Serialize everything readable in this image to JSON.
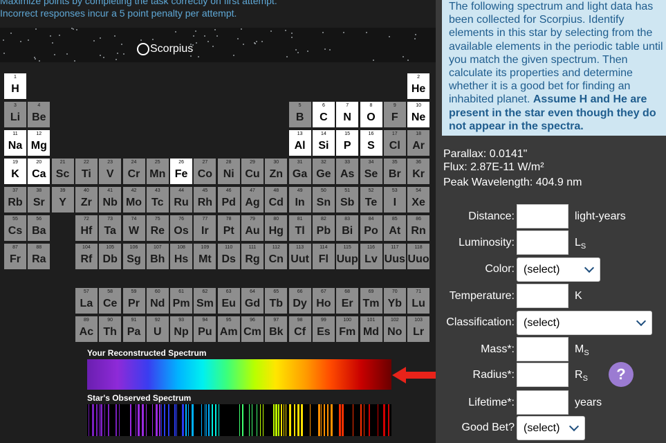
{
  "top_note": {
    "line1": "Maximize points by completing the task correctly on first attempt.",
    "line2": "Incorrect responses incur a 5 point penalty per attempt."
  },
  "star_name": "Scorpius",
  "elements": [
    {
      "n": "1",
      "s": "H",
      "r": 0,
      "c": 0,
      "on": true
    },
    {
      "n": "2",
      "s": "He",
      "r": 0,
      "c": 17,
      "on": true
    },
    {
      "n": "3",
      "s": "Li",
      "r": 1,
      "c": 0
    },
    {
      "n": "4",
      "s": "Be",
      "r": 1,
      "c": 1
    },
    {
      "n": "5",
      "s": "B",
      "r": 1,
      "c": 12
    },
    {
      "n": "6",
      "s": "C",
      "r": 1,
      "c": 13,
      "on": true
    },
    {
      "n": "7",
      "s": "N",
      "r": 1,
      "c": 14,
      "on": true
    },
    {
      "n": "8",
      "s": "O",
      "r": 1,
      "c": 15,
      "on": true
    },
    {
      "n": "9",
      "s": "F",
      "r": 1,
      "c": 16
    },
    {
      "n": "10",
      "s": "Ne",
      "r": 1,
      "c": 17,
      "on": true
    },
    {
      "n": "11",
      "s": "Na",
      "r": 2,
      "c": 0,
      "on": true
    },
    {
      "n": "12",
      "s": "Mg",
      "r": 2,
      "c": 1,
      "on": true
    },
    {
      "n": "13",
      "s": "Al",
      "r": 2,
      "c": 12,
      "on": true
    },
    {
      "n": "14",
      "s": "Si",
      "r": 2,
      "c": 13,
      "on": true
    },
    {
      "n": "15",
      "s": "P",
      "r": 2,
      "c": 14,
      "on": true
    },
    {
      "n": "16",
      "s": "S",
      "r": 2,
      "c": 15,
      "on": true
    },
    {
      "n": "17",
      "s": "Cl",
      "r": 2,
      "c": 16
    },
    {
      "n": "18",
      "s": "Ar",
      "r": 2,
      "c": 17
    },
    {
      "n": "19",
      "s": "K",
      "r": 3,
      "c": 0,
      "on": true
    },
    {
      "n": "20",
      "s": "Ca",
      "r": 3,
      "c": 1,
      "on": true
    },
    {
      "n": "21",
      "s": "Sc",
      "r": 3,
      "c": 2
    },
    {
      "n": "22",
      "s": "Ti",
      "r": 3,
      "c": 3
    },
    {
      "n": "23",
      "s": "V",
      "r": 3,
      "c": 4
    },
    {
      "n": "24",
      "s": "Cr",
      "r": 3,
      "c": 5
    },
    {
      "n": "25",
      "s": "Mn",
      "r": 3,
      "c": 6
    },
    {
      "n": "26",
      "s": "Fe",
      "r": 3,
      "c": 7,
      "on": true
    },
    {
      "n": "27",
      "s": "Co",
      "r": 3,
      "c": 8
    },
    {
      "n": "28",
      "s": "Ni",
      "r": 3,
      "c": 9
    },
    {
      "n": "29",
      "s": "Cu",
      "r": 3,
      "c": 10
    },
    {
      "n": "30",
      "s": "Zn",
      "r": 3,
      "c": 11
    },
    {
      "n": "31",
      "s": "Ga",
      "r": 3,
      "c": 12
    },
    {
      "n": "32",
      "s": "Ge",
      "r": 3,
      "c": 13
    },
    {
      "n": "33",
      "s": "As",
      "r": 3,
      "c": 14
    },
    {
      "n": "34",
      "s": "Se",
      "r": 3,
      "c": 15
    },
    {
      "n": "35",
      "s": "Br",
      "r": 3,
      "c": 16
    },
    {
      "n": "36",
      "s": "Kr",
      "r": 3,
      "c": 17
    },
    {
      "n": "37",
      "s": "Rb",
      "r": 4,
      "c": 0
    },
    {
      "n": "38",
      "s": "Sr",
      "r": 4,
      "c": 1
    },
    {
      "n": "39",
      "s": "Y",
      "r": 4,
      "c": 2
    },
    {
      "n": "40",
      "s": "Zr",
      "r": 4,
      "c": 3
    },
    {
      "n": "41",
      "s": "Nb",
      "r": 4,
      "c": 4
    },
    {
      "n": "42",
      "s": "Mo",
      "r": 4,
      "c": 5
    },
    {
      "n": "43",
      "s": "Tc",
      "r": 4,
      "c": 6
    },
    {
      "n": "44",
      "s": "Ru",
      "r": 4,
      "c": 7
    },
    {
      "n": "45",
      "s": "Rh",
      "r": 4,
      "c": 8
    },
    {
      "n": "46",
      "s": "Pd",
      "r": 4,
      "c": 9
    },
    {
      "n": "47",
      "s": "Ag",
      "r": 4,
      "c": 10
    },
    {
      "n": "48",
      "s": "Cd",
      "r": 4,
      "c": 11
    },
    {
      "n": "49",
      "s": "In",
      "r": 4,
      "c": 12
    },
    {
      "n": "50",
      "s": "Sn",
      "r": 4,
      "c": 13
    },
    {
      "n": "51",
      "s": "Sb",
      "r": 4,
      "c": 14
    },
    {
      "n": "52",
      "s": "Te",
      "r": 4,
      "c": 15
    },
    {
      "n": "53",
      "s": "I",
      "r": 4,
      "c": 16
    },
    {
      "n": "54",
      "s": "Xe",
      "r": 4,
      "c": 17
    },
    {
      "n": "55",
      "s": "Cs",
      "r": 5,
      "c": 0
    },
    {
      "n": "56",
      "s": "Ba",
      "r": 5,
      "c": 1
    },
    {
      "n": "72",
      "s": "Hf",
      "r": 5,
      "c": 3
    },
    {
      "n": "73",
      "s": "Ta",
      "r": 5,
      "c": 4
    },
    {
      "n": "74",
      "s": "W",
      "r": 5,
      "c": 5
    },
    {
      "n": "75",
      "s": "Re",
      "r": 5,
      "c": 6
    },
    {
      "n": "76",
      "s": "Os",
      "r": 5,
      "c": 7
    },
    {
      "n": "77",
      "s": "Ir",
      "r": 5,
      "c": 8
    },
    {
      "n": "78",
      "s": "Pt",
      "r": 5,
      "c": 9
    },
    {
      "n": "79",
      "s": "Au",
      "r": 5,
      "c": 10
    },
    {
      "n": "80",
      "s": "Hg",
      "r": 5,
      "c": 11
    },
    {
      "n": "81",
      "s": "Tl",
      "r": 5,
      "c": 12
    },
    {
      "n": "82",
      "s": "Pb",
      "r": 5,
      "c": 13
    },
    {
      "n": "83",
      "s": "Bi",
      "r": 5,
      "c": 14
    },
    {
      "n": "84",
      "s": "Po",
      "r": 5,
      "c": 15
    },
    {
      "n": "85",
      "s": "At",
      "r": 5,
      "c": 16
    },
    {
      "n": "86",
      "s": "Rn",
      "r": 5,
      "c": 17
    },
    {
      "n": "87",
      "s": "Fr",
      "r": 6,
      "c": 0
    },
    {
      "n": "88",
      "s": "Ra",
      "r": 6,
      "c": 1
    },
    {
      "n": "104",
      "s": "Rf",
      "r": 6,
      "c": 3
    },
    {
      "n": "105",
      "s": "Db",
      "r": 6,
      "c": 4
    },
    {
      "n": "106",
      "s": "Sg",
      "r": 6,
      "c": 5
    },
    {
      "n": "107",
      "s": "Bh",
      "r": 6,
      "c": 6
    },
    {
      "n": "108",
      "s": "Hs",
      "r": 6,
      "c": 7
    },
    {
      "n": "109",
      "s": "Mt",
      "r": 6,
      "c": 8
    },
    {
      "n": "110",
      "s": "Ds",
      "r": 6,
      "c": 9
    },
    {
      "n": "111",
      "s": "Rg",
      "r": 6,
      "c": 10
    },
    {
      "n": "112",
      "s": "Cn",
      "r": 6,
      "c": 11
    },
    {
      "n": "113",
      "s": "Uut",
      "r": 6,
      "c": 12
    },
    {
      "n": "114",
      "s": "Fl",
      "r": 6,
      "c": 13
    },
    {
      "n": "115",
      "s": "Uup",
      "r": 6,
      "c": 14
    },
    {
      "n": "116",
      "s": "Lv",
      "r": 6,
      "c": 15
    },
    {
      "n": "117",
      "s": "Uus",
      "r": 6,
      "c": 16
    },
    {
      "n": "118",
      "s": "Uuo",
      "r": 6,
      "c": 17
    },
    {
      "n": "57",
      "s": "La",
      "r": 7,
      "c": 3
    },
    {
      "n": "58",
      "s": "Ce",
      "r": 7,
      "c": 4
    },
    {
      "n": "59",
      "s": "Pr",
      "r": 7,
      "c": 5
    },
    {
      "n": "60",
      "s": "Nd",
      "r": 7,
      "c": 6
    },
    {
      "n": "61",
      "s": "Pm",
      "r": 7,
      "c": 7
    },
    {
      "n": "62",
      "s": "Sm",
      "r": 7,
      "c": 8
    },
    {
      "n": "63",
      "s": "Eu",
      "r": 7,
      "c": 9
    },
    {
      "n": "64",
      "s": "Gd",
      "r": 7,
      "c": 10
    },
    {
      "n": "65",
      "s": "Tb",
      "r": 7,
      "c": 11
    },
    {
      "n": "66",
      "s": "Dy",
      "r": 7,
      "c": 12
    },
    {
      "n": "67",
      "s": "Ho",
      "r": 7,
      "c": 13
    },
    {
      "n": "68",
      "s": "Er",
      "r": 7,
      "c": 14
    },
    {
      "n": "69",
      "s": "Tm",
      "r": 7,
      "c": 15
    },
    {
      "n": "70",
      "s": "Yb",
      "r": 7,
      "c": 16
    },
    {
      "n": "71",
      "s": "Lu",
      "r": 7,
      "c": 17
    },
    {
      "n": "89",
      "s": "Ac",
      "r": 8,
      "c": 3
    },
    {
      "n": "90",
      "s": "Th",
      "r": 8,
      "c": 4
    },
    {
      "n": "91",
      "s": "Pa",
      "r": 8,
      "c": 5
    },
    {
      "n": "92",
      "s": "U",
      "r": 8,
      "c": 6
    },
    {
      "n": "93",
      "s": "Np",
      "r": 8,
      "c": 7
    },
    {
      "n": "94",
      "s": "Pu",
      "r": 8,
      "c": 8
    },
    {
      "n": "95",
      "s": "Am",
      "r": 8,
      "c": 9
    },
    {
      "n": "96",
      "s": "Cm",
      "r": 8,
      "c": 10
    },
    {
      "n": "97",
      "s": "Bk",
      "r": 8,
      "c": 11
    },
    {
      "n": "98",
      "s": "Cf",
      "r": 8,
      "c": 12
    },
    {
      "n": "99",
      "s": "Es",
      "r": 8,
      "c": 13
    },
    {
      "n": "100",
      "s": "Fm",
      "r": 8,
      "c": 14
    },
    {
      "n": "101",
      "s": "Md",
      "r": 8,
      "c": 15
    },
    {
      "n": "102",
      "s": "No",
      "r": 8,
      "c": 16
    },
    {
      "n": "103",
      "s": "Lr",
      "r": 8,
      "c": 17
    }
  ],
  "spectra": {
    "reconstructed_label": "Your Reconstructed Spectrum",
    "observed_label": "Star's Observed Spectrum",
    "arrow_color": "#e8231a"
  },
  "info": {
    "text": "The following spectrum and light data has been collected for Scorpius. Identify elements in this star by selecting from the available elements in the periodic table until you match the given spectrum. Then calculate its properties and determine whether it is a good bet for finding an inhabited planet. ",
    "bold": "Assume H and He are present in the star even though they do not appear in the spectra."
  },
  "observations": {
    "parallax": "Parallax: 0.0141\"",
    "flux": "Flux: 2.87E-11 W/m²",
    "peak": "Peak Wavelength: 404.9 nm"
  },
  "form": {
    "distance_label": "Distance:",
    "distance_unit": "light-years",
    "luminosity_label": "Luminosity:",
    "luminosity_unit": "L",
    "color_label": "Color:",
    "color_value": "(select)",
    "temperature_label": "Temperature:",
    "temperature_unit": "K",
    "classification_label": "Classification:",
    "classification_value": "(select)",
    "mass_label": "Mass*:",
    "mass_unit": "M",
    "radius_label": "Radius*:",
    "radius_unit": "R",
    "lifetime_label": "Lifetime*:",
    "lifetime_unit": "years",
    "goodbet_label": "Good Bet?",
    "goodbet_value": "(select)",
    "solar_subscript": "S",
    "help_label": "?"
  }
}
